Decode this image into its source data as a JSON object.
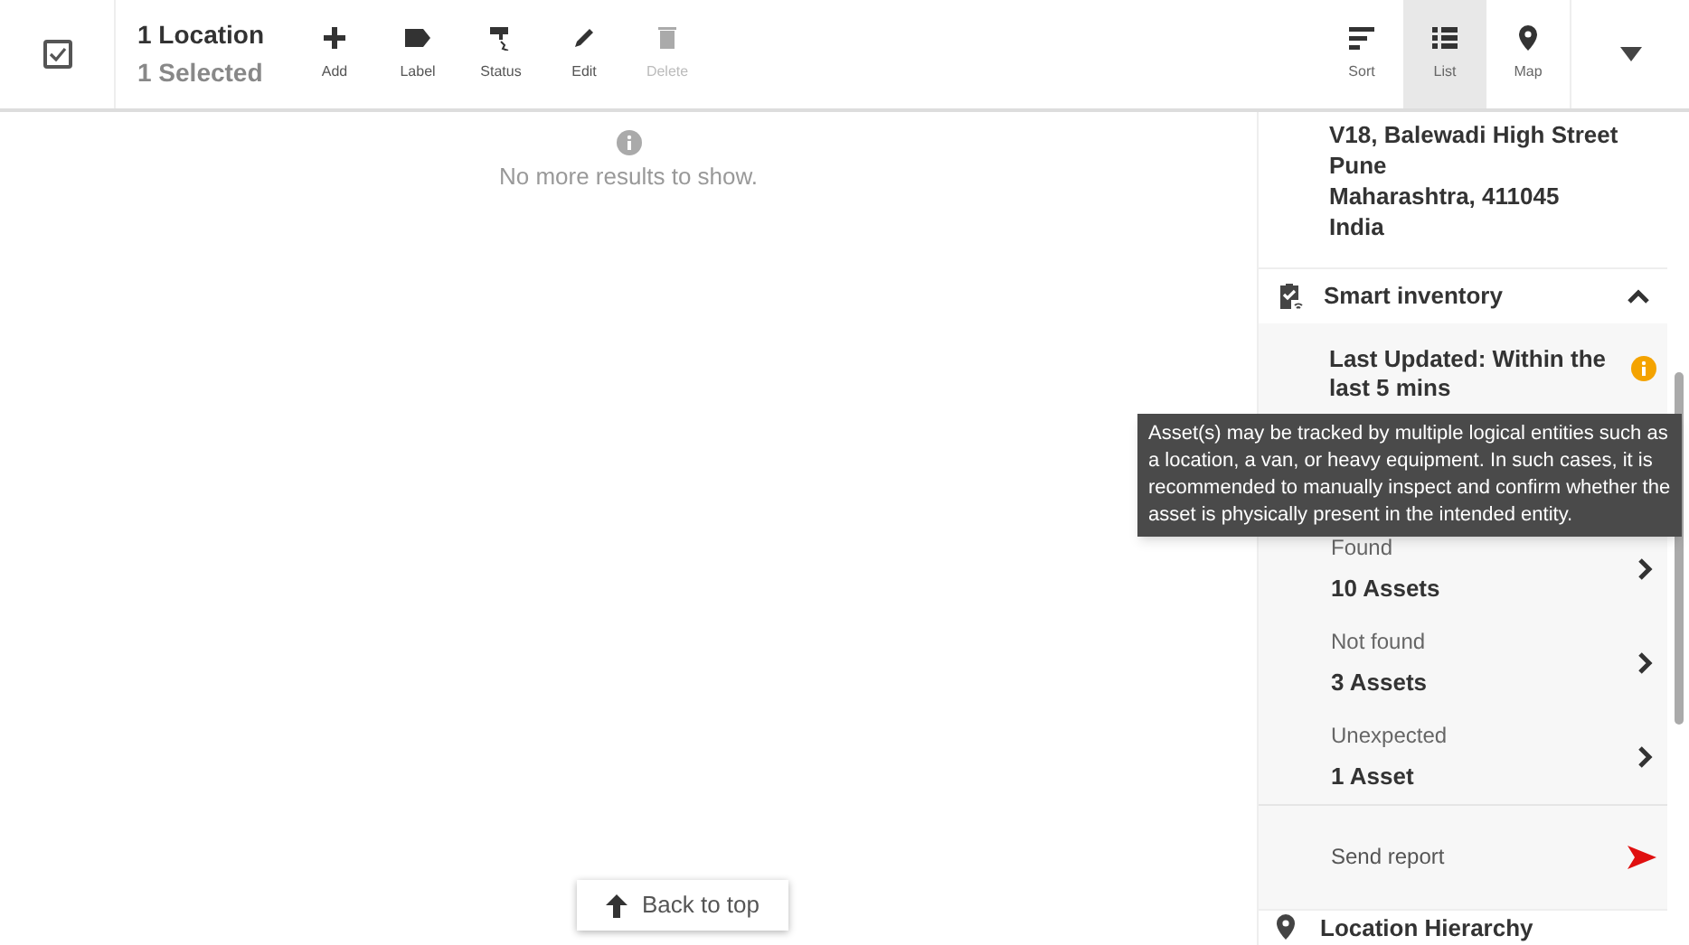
{
  "selection": {
    "checked": true,
    "title": "1 Location",
    "subtitle": "1 Selected"
  },
  "actions": [
    {
      "kind": "add",
      "label": "Add",
      "disabled": false
    },
    {
      "kind": "label",
      "label": "Label",
      "disabled": false
    },
    {
      "kind": "status",
      "label": "Status",
      "disabled": false
    },
    {
      "kind": "edit",
      "label": "Edit",
      "disabled": false
    },
    {
      "kind": "delete",
      "label": "Delete",
      "disabled": true
    }
  ],
  "views": [
    {
      "kind": "sort",
      "label": "Sort",
      "selected": false
    },
    {
      "kind": "list",
      "label": "List",
      "selected": true
    },
    {
      "kind": "map",
      "label": "Map",
      "selected": false
    }
  ],
  "results_message": "No more results to show.",
  "back_to_top": "Back to top",
  "address": [
    "V18, Balewadi High Street",
    "Pune",
    "Maharashtra, 411045",
    "India"
  ],
  "smart_inventory": {
    "title": "Smart inventory",
    "expanded": true,
    "last_updated": "Last Updated: Within the last 5 mins",
    "tooltip": "Asset(s) may be tracked by multiple logical entities such as a location, a van, or heavy equipment. In such cases, it is recommended to manually inspect and confirm whether the asset is physically present in the intended entity.",
    "results": [
      {
        "label": "Found",
        "value": "10 Assets"
      },
      {
        "label": "Not found",
        "value": "3 Assets"
      },
      {
        "label": "Unexpected",
        "value": "1 Asset"
      }
    ],
    "send_report": "Send report"
  },
  "location_hierarchy": "Location Hierarchy"
}
